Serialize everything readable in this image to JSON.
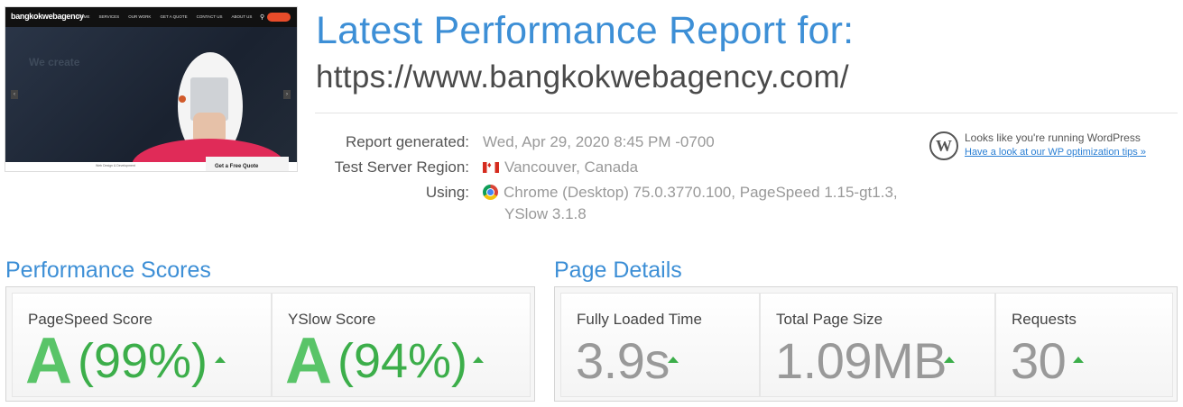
{
  "thumbnail": {
    "logo": "bangkokwebagency",
    "menu": [
      "HOME",
      "SERVICES",
      "OUR WORK",
      "GET A QUOTE",
      "CONTACT US",
      "ABOUT US"
    ],
    "hero_text": "We create",
    "footer_text": "Web Design & Development",
    "cta": "Get a Free Quote"
  },
  "header": {
    "title": "Latest Performance Report for:",
    "url": "https://www.bangkokwebagency.com/"
  },
  "report": {
    "generated_label": "Report generated:",
    "generated_value": "Wed, Apr 29, 2020 8:45 PM -0700",
    "region_label": "Test Server Region:",
    "region_value": "Vancouver, Canada",
    "using_label": "Using:",
    "using_value_line1": "Chrome (Desktop) 75.0.3770.100, PageSpeed 1.15-gt1.3,",
    "using_value_line2": "YSlow 3.1.8"
  },
  "wordpress": {
    "icon": "wordpress-icon",
    "message": "Looks like you're running WordPress",
    "link": "Have a look at our WP optimization tips »"
  },
  "performance_scores": {
    "title": "Performance Scores",
    "pagespeed": {
      "label": "PageSpeed Score",
      "grade": "A",
      "percent": "(99%)"
    },
    "yslow": {
      "label": "YSlow Score",
      "grade": "A",
      "percent": "(94%)"
    }
  },
  "page_details": {
    "title": "Page Details",
    "fully_loaded": {
      "label": "Fully Loaded Time",
      "value": "3.9s"
    },
    "page_size": {
      "label": "Total Page Size",
      "value": "1.09MB"
    },
    "requests": {
      "label": "Requests",
      "value": "30"
    }
  },
  "colors": {
    "accent_blue": "#3d8fd6",
    "grade_green": "#3cae4a",
    "link_blue": "#2a7fd4"
  }
}
